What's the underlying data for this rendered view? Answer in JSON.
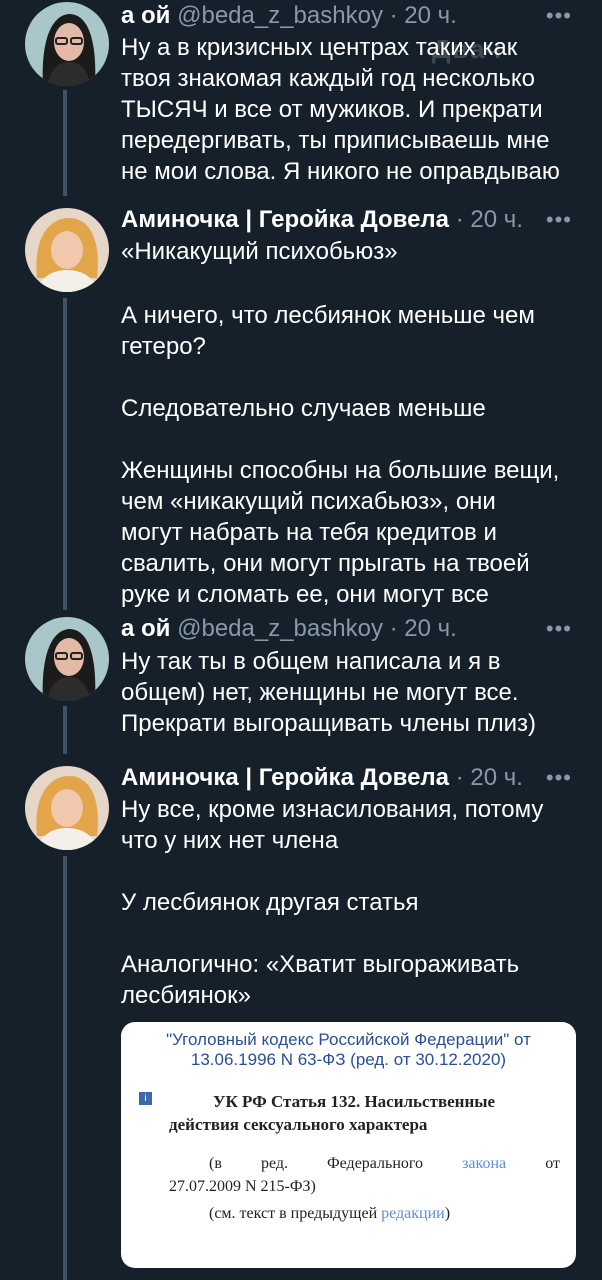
{
  "watermark": "Двач",
  "tweets": [
    {
      "author_name": "а ой",
      "handle": "@beda_z_bashkoy",
      "time": "20 ч.",
      "more": "•••",
      "lines": [
        "Ну а в кризисных центрах таких как",
        "твоя знакомая каждый год несколько",
        "ТЫСЯЧ и все от мужиков. И прекрати",
        "передергивать, ты приписываешь мне",
        "не мои слова. Я никого не оправдываю"
      ]
    },
    {
      "author_name": "Аминочка | Геройка Довела",
      "time": "20 ч.",
      "more": "•••",
      "paragraphs": [
        [
          "«Никакущий психобьюз»"
        ],
        [
          "А ничего, что лесбиянок меньше чем",
          "гетеро?"
        ],
        [
          "Следовательно случаев меньше"
        ],
        [
          "Женщины способны на большие вещи,",
          "чем «никакущий психабьюз», они",
          "могут набрать на тебя кредитов и",
          "свалить, они могут прыгать на твоей",
          "руке и сломать ее, они могут все"
        ]
      ]
    },
    {
      "author_name": "а ой",
      "handle": "@beda_z_bashkoy",
      "time": "20 ч.",
      "more": "•••",
      "lines": [
        "Ну так ты в общем написала и я в",
        "общем) нет, женщины не могут все.",
        "Прекрати выгоращивать члены плиз)"
      ]
    },
    {
      "author_name": "Аминочка | Геройка Довела",
      "time": "20 ч.",
      "more": "•••",
      "paragraphs": [
        [
          "Ну все, кроме изнасилования, потому",
          "что у них нет члена"
        ],
        [
          "У лесбиянок другая статья"
        ],
        [
          "Аналогично: «Хватит выгораживать",
          "лесбиянок»"
        ]
      ]
    }
  ],
  "document": {
    "header_line1": "\"Уголовный кодекс Российской Федерации\" от",
    "header_line2": "13.06.1996 N 63-ФЗ (ред. от 30.12.2020)",
    "info_icon": "i",
    "title_line1": "УК РФ Статья 132. Насильственные",
    "title_line2": "действия сексуального характера",
    "note_a": "(в",
    "note_b": "ред.",
    "note_c": "Федерального",
    "note_link1": "закона",
    "note_d": "от",
    "note_line2": "27.07.2009 N 215-ФЗ)",
    "note_line3_pre": "(см. текст в предыдущей ",
    "note_link2": "редакции",
    "note_line3_post": ")"
  },
  "colors": {
    "background": "#15202b",
    "secondary_text": "#8899a6",
    "thread_line": "#3d5466",
    "link": "#5b8fd4"
  }
}
